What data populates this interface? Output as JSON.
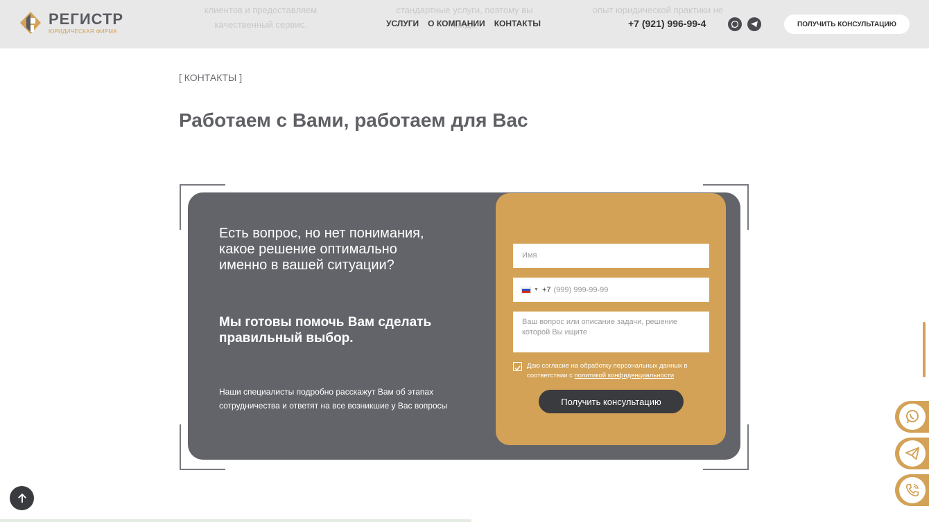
{
  "header": {
    "logo_name": "РЕГИСТР",
    "logo_sub": "ЮРИДИЧЕСКАЯ ФИРМА",
    "ghost_texts": [
      {
        "line1": "клиентов и предоставляем",
        "line2": "качественный сервис."
      },
      {
        "line1": "стандартные услуги, поэтому вы",
        "line2": "когда"
      },
      {
        "line1": "опыт юридической практики не",
        "line2": ""
      }
    ],
    "nav": [
      "УСЛУГИ",
      "О КОМПАНИИ",
      "КОНТАКТЫ"
    ],
    "phone": "+7 (921) 996-99-4",
    "cta": "ПОЛУЧИТЬ КОНСУЛЬТАЦИЮ"
  },
  "breadcrumb": "[ КОНТАКТЫ ]",
  "title": "Работаем с Вами, работаем для Вас",
  "card": {
    "question": "Есть вопрос, но нет понимания, какое решение оптимально именно в вашей ситуации?",
    "ready": "Мы готовы помочь Вам сделать правильный выбор.",
    "description": "Наши специалисты подробно расскажут Вам об этапах сотрудничества и ответят на все возникшие у Вас вопросы"
  },
  "form": {
    "name_placeholder": "Имя",
    "phone_code": "+7",
    "phone_placeholder": "(999) 999-99-99",
    "message_placeholder": "Ваш вопрос или описание задачи, решение которой Вы ищите",
    "consent_text": "Даю согласие на обработку персональных данных в соответствии с ",
    "consent_link": "политикой конфиденциальности",
    "consent_checked": true,
    "submit": "Получить консультацию"
  },
  "colors": {
    "accent": "#d3a256",
    "card_bg": "#626469",
    "dark": "#3a3b3e",
    "header_bg": "#e8e8e8"
  },
  "icons": [
    "whatsapp-icon",
    "telegram-icon",
    "phone-call-icon",
    "arrow-up-icon",
    "checkmark-icon"
  ]
}
